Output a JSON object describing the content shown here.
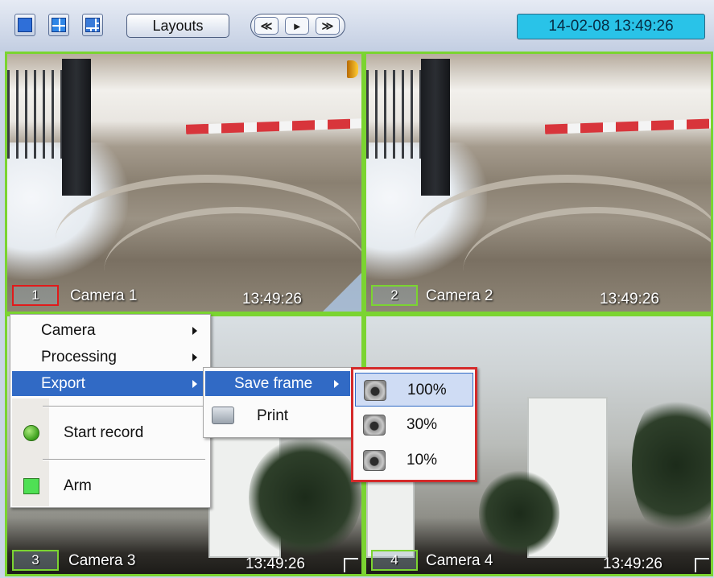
{
  "toolbar": {
    "layouts_label": "Layouts",
    "nav": [
      "≪",
      "▸",
      "≫"
    ],
    "clock": "14-02-08  13:49:26",
    "icons": [
      "single-view-icon",
      "quad-view-icon",
      "multi-view-icon"
    ]
  },
  "cameras": [
    {
      "id": "1",
      "name": "Camera 1",
      "time": "13:49:26"
    },
    {
      "id": "2",
      "name": "Camera 2",
      "time": "13:49:26"
    },
    {
      "id": "3",
      "name": "Camera 3",
      "time": "13:49:26"
    },
    {
      "id": "4",
      "name": "Camera 4",
      "time": "13:49:26"
    }
  ],
  "context_menu": {
    "items": [
      "Camera",
      "Processing",
      "Export",
      "Start record",
      "Arm"
    ],
    "highlighted": "Export"
  },
  "export_menu": {
    "items": [
      "Save frame",
      "Print"
    ],
    "highlighted": "Save frame"
  },
  "save_frame_menu": {
    "items": [
      "100%",
      "30%",
      "10%"
    ],
    "selected": "100%"
  },
  "colors": {
    "frame_border": "#7bd431",
    "active_label_border": "#e11a1a",
    "menu_highlight": "#316ac5",
    "clock_bg": "#29c3e8",
    "callout_border": "#d42a2a"
  }
}
